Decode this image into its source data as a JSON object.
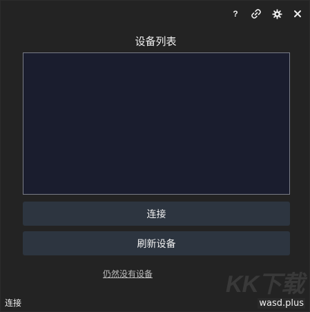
{
  "titlebar": {
    "help_label": "?",
    "icons": [
      "help-icon",
      "link-icon",
      "gear-icon",
      "close-icon"
    ]
  },
  "device_section": {
    "title": "设备列表"
  },
  "buttons": {
    "connect_label": "连接",
    "refresh_label": "刷新设备"
  },
  "links": {
    "no_device": "仍然没有设备"
  },
  "status": {
    "text": "连接"
  },
  "footer": {
    "site": "wasd.plus",
    "watermark": "KK下载"
  },
  "colors": {
    "background": "#232323",
    "list_background": "#1a1d2e",
    "list_border": "#7a7d88",
    "button_background": "#2d3540",
    "text": "#f0f0f0"
  }
}
